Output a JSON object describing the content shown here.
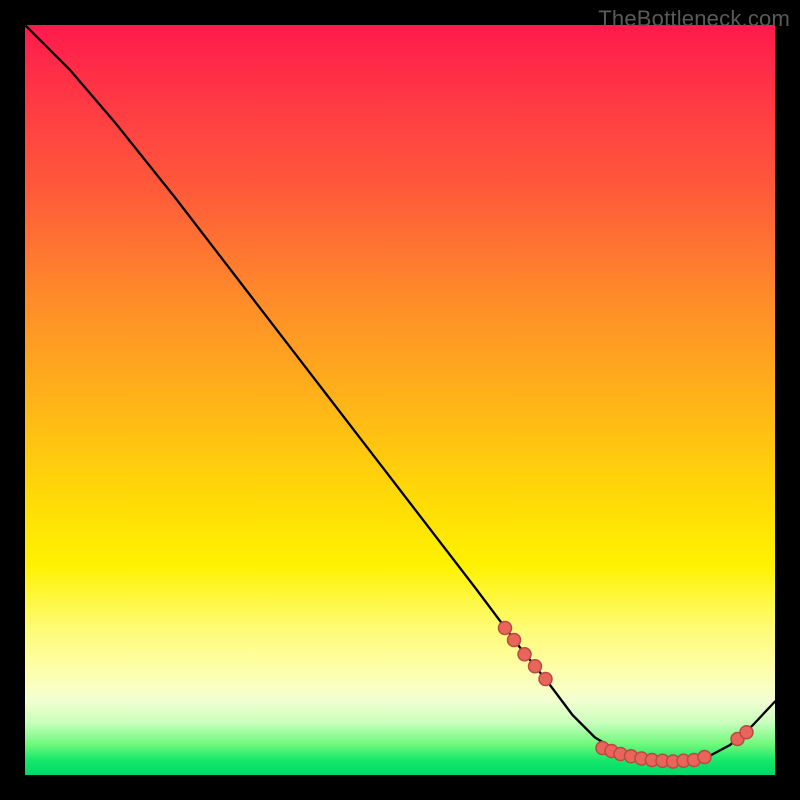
{
  "watermark": "TheBottleneck.com",
  "colors": {
    "bg": "#000000",
    "marker_fill": "#e9655b",
    "marker_stroke": "#b84a42",
    "curve": "#000000"
  },
  "chart_data": {
    "type": "line",
    "title": "",
    "xlabel": "",
    "ylabel": "",
    "xlim": [
      0,
      100
    ],
    "ylim": [
      0,
      100
    ],
    "series": [
      {
        "name": "bottleneck-curve",
        "x": [
          0,
          6,
          12,
          20,
          30,
          40,
          50,
          60,
          66,
          70,
          73,
          76,
          79,
          82,
          85,
          88,
          91,
          94,
          97,
          100
        ],
        "y": [
          100,
          94,
          87,
          77,
          64,
          51,
          38,
          25,
          17,
          12,
          8,
          5,
          3.2,
          2.2,
          1.8,
          1.8,
          2.4,
          4.0,
          6.6,
          9.8
        ]
      }
    ],
    "markers": [
      {
        "x": 64.0,
        "y": 19.6
      },
      {
        "x": 65.2,
        "y": 18.0
      },
      {
        "x": 66.6,
        "y": 16.1
      },
      {
        "x": 68.0,
        "y": 14.5
      },
      {
        "x": 69.4,
        "y": 12.8
      },
      {
        "x": 77.0,
        "y": 3.6
      },
      {
        "x": 78.2,
        "y": 3.2
      },
      {
        "x": 79.4,
        "y": 2.8
      },
      {
        "x": 80.8,
        "y": 2.5
      },
      {
        "x": 82.2,
        "y": 2.2
      },
      {
        "x": 83.6,
        "y": 2.0
      },
      {
        "x": 85.0,
        "y": 1.9
      },
      {
        "x": 86.4,
        "y": 1.8
      },
      {
        "x": 87.8,
        "y": 1.9
      },
      {
        "x": 89.2,
        "y": 2.0
      },
      {
        "x": 90.6,
        "y": 2.4
      },
      {
        "x": 95.0,
        "y": 4.8
      },
      {
        "x": 96.2,
        "y": 5.7
      }
    ]
  }
}
